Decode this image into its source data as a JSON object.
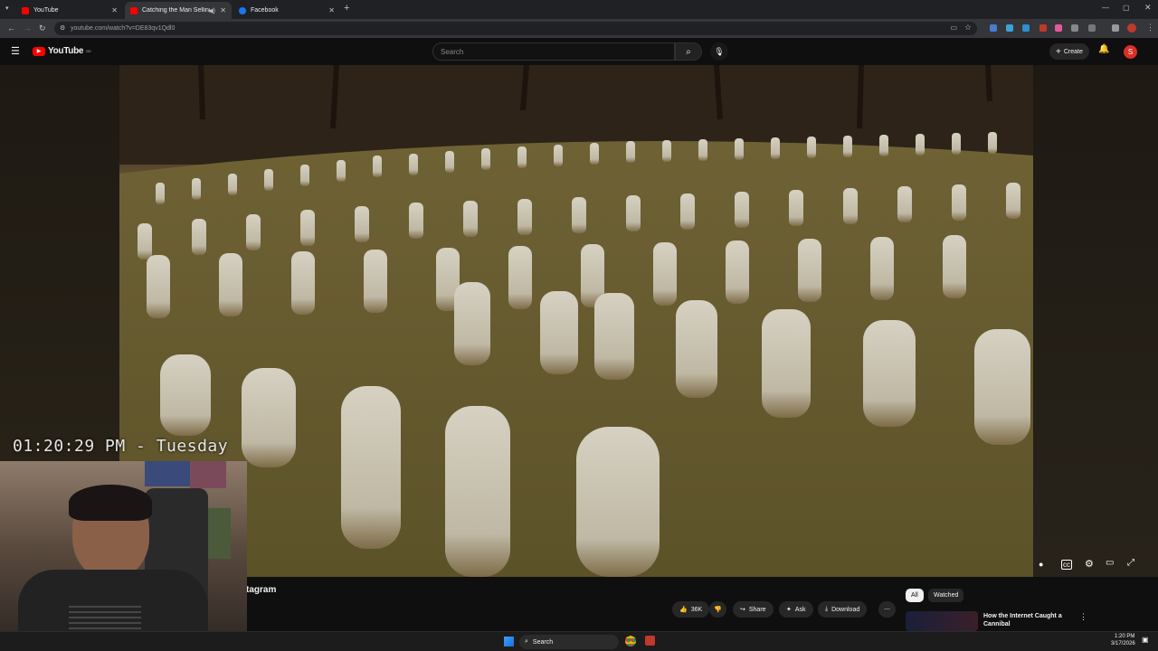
{
  "browser": {
    "tabs": [
      {
        "title": "YouTube",
        "color": "#ff0000"
      },
      {
        "title": "Catching the Man Selling D",
        "color": "#ff0000",
        "active": true
      },
      {
        "title": "Facebook",
        "color": "#1877f2"
      }
    ],
    "new_tab_label": "+",
    "url": "youtube.com/watch?v=DE83qv1Qdl0"
  },
  "youtube": {
    "logo": "YouTube",
    "country_badge": "BD",
    "search_placeholder": "Search",
    "create_label": "Create",
    "avatar_letter": "S"
  },
  "overlay": {
    "clock_text": "01:20:29 PM - Tuesday"
  },
  "video": {
    "title_fragment": "tagram"
  },
  "actions": {
    "like_count": "36K",
    "share_label": "Share",
    "ask_label": "Ask",
    "download_label": "Download"
  },
  "sidebar": {
    "chips": [
      "All",
      "Watched"
    ],
    "next_video_title": "How the Internet Caught a Cannibal"
  },
  "taskbar": {
    "search_label": "Search",
    "time": "1:20 PM",
    "date": "3/17/2026"
  }
}
